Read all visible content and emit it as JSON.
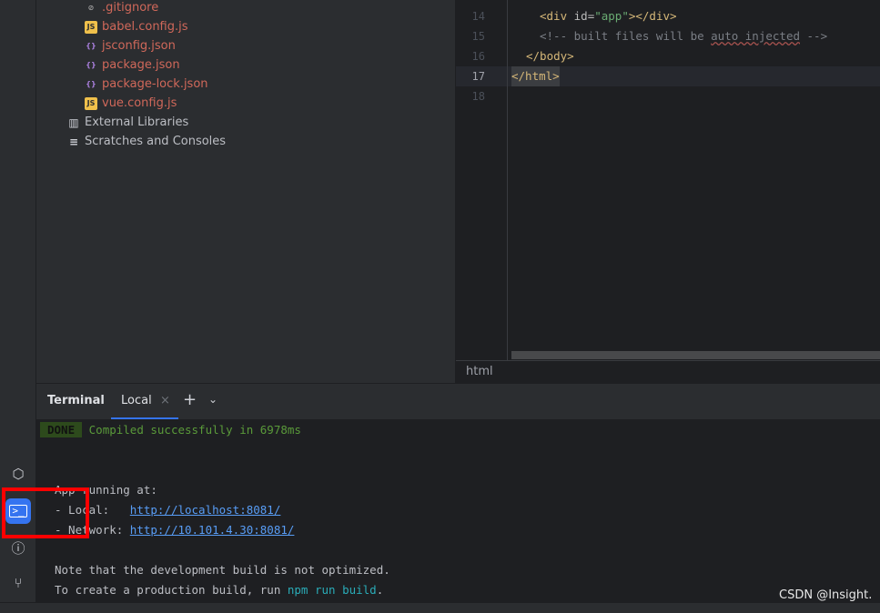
{
  "project_tree": {
    "items": [
      {
        "label": ".gitignore",
        "icon": "ignore-icon"
      },
      {
        "label": "babel.config.js",
        "icon": "js-file-icon",
        "icon_text": "JS"
      },
      {
        "label": "jsconfig.json",
        "icon": "json-file-icon",
        "icon_text": "{}"
      },
      {
        "label": "package.json",
        "icon": "json-file-icon",
        "icon_text": "{}"
      },
      {
        "label": "package-lock.json",
        "icon": "json-file-icon",
        "icon_text": "{}"
      },
      {
        "label": "vue.config.js",
        "icon": "js-file-icon",
        "icon_text": "JS"
      }
    ],
    "external_libraries": "External Libraries",
    "scratches": "Scratches and Consoles"
  },
  "editor": {
    "lines": [
      {
        "num": "14",
        "tag_open": "<div ",
        "attr": "id=",
        "value": "\"app\"",
        "tag_close": "></div>"
      },
      {
        "num": "15",
        "comment_a": "<!-- built files will be ",
        "comment_typo": "auto injected",
        "comment_b": " -->"
      },
      {
        "num": "16",
        "text": "</body>"
      },
      {
        "num": "17",
        "text": "</html>"
      },
      {
        "num": "18"
      }
    ],
    "breadcrumb": "html"
  },
  "terminal": {
    "title": "Terminal",
    "tab": "Local",
    "done_badge": "DONE",
    "compiled": "Compiled successfully in 6978ms",
    "running": "App running at:",
    "local_label": "- Local:   ",
    "local_url": "http://localhost:8081/",
    "network_label": "- Network: ",
    "network_url": "http://10.101.4.30:8081/",
    "note": "Note that the development build is not optimized.",
    "create_a": "To create a production build, run ",
    "create_cmd": "npm run build",
    "create_b": "."
  },
  "watermark": "CSDN @Insight.",
  "colors": {
    "accent": "#3574f0",
    "annotation": "#ff0000",
    "done_bg": "#2d4a1c",
    "done_text": "#5a9a3a"
  }
}
